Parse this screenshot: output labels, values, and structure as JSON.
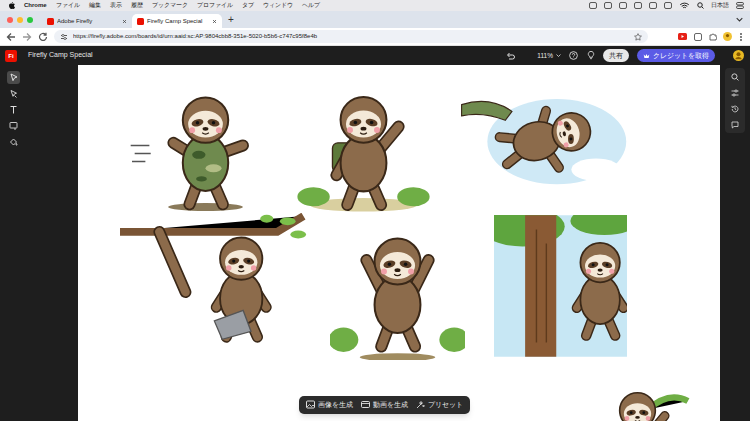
{
  "menubar": {
    "app": "Chrome",
    "items": [
      "ファイル",
      "編集",
      "表示",
      "履歴",
      "ブックマーク",
      "プロファイル",
      "タブ",
      "ウィンドウ",
      "ヘルプ"
    ],
    "input_method": "日本語"
  },
  "tabs": [
    {
      "label": "Adobe Firefly",
      "selected": false
    },
    {
      "label": "Firefly Camp Special",
      "selected": true
    }
  ],
  "new_tab": "+",
  "address": {
    "url": "https://firefly.adobe.com/boards/id/urn:aaid:sc:AP:9804cbb8-351e-5020-b5b6-c747c95f8e4b"
  },
  "app": {
    "logo": "Fi",
    "title": "Firefly Camp Special",
    "zoom": "111%",
    "share": "共有",
    "credits": "クレジットを取得"
  },
  "left_tools": [
    {
      "kind": "select",
      "selected": true
    },
    {
      "kind": "lasso",
      "selected": false
    },
    {
      "kind": "text",
      "selected": false
    },
    {
      "kind": "frame",
      "selected": false
    },
    {
      "kind": "fill",
      "selected": false
    }
  ],
  "bottom_toolbar": [
    "画像を生成",
    "動画を生成",
    "プリセット"
  ]
}
